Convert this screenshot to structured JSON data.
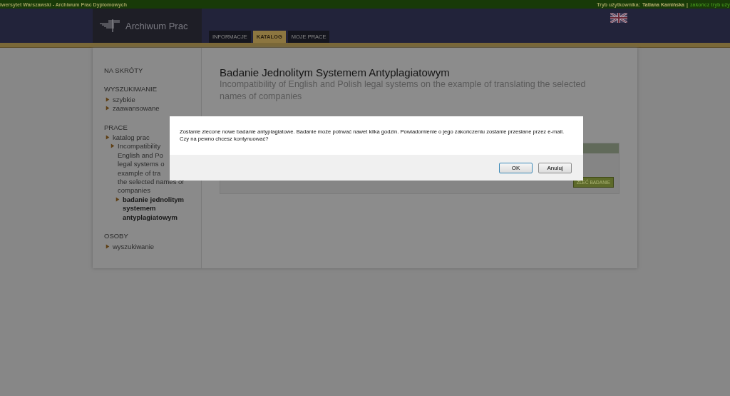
{
  "top_bar": {
    "site": "iwersytet Warszawski - Archiwum Prac Dyplomowych",
    "user_label": "Tryb użytkownika:",
    "user_name": "Tatiana Kamińska",
    "separator": "|",
    "exit_link": "zakończ tryb uży"
  },
  "header": {
    "logo_text": "Archiwum Prac"
  },
  "tabs": [
    {
      "label": "INFORMACJE",
      "selected": false
    },
    {
      "label": "KATALOG",
      "selected": true
    },
    {
      "label": "MOJE PRACE",
      "selected": false
    }
  ],
  "sidebar": {
    "sections": [
      {
        "title": "NA SKRÓTY"
      },
      {
        "title": "WYSZUKIWANIE",
        "items": [
          {
            "label": "szybkie",
            "selected": false
          },
          {
            "label": "zaawansowane",
            "selected": false
          }
        ]
      },
      {
        "title": "PRACE",
        "items": [
          {
            "label": "katalog prac",
            "selected": false,
            "children": [
              {
                "label_lines": [
                  "Incompatibility",
                  "English and Po",
                  "legal systems o",
                  "example of tra",
                  "the selected names of",
                  "companies"
                ],
                "selected": false,
                "children": [
                  {
                    "label": "badanie jednolitym systemem antyplagiatowym",
                    "selected": true
                  }
                ]
              }
            ]
          }
        ]
      },
      {
        "title": "OSOBY",
        "items": [
          {
            "label": "wyszukiwanie",
            "selected": false
          }
        ]
      }
    ]
  },
  "main": {
    "title": "Badanie Jednolitym Systemem Antyplagiatowym",
    "subtitle": "Incompatibility of English and Polish legal systems on the example of translating the selected names of companies",
    "order_button": "ZLEĆ BADANIE"
  },
  "dialog": {
    "message": "Zostanie zlecone nowe badanie antyplagiatowe. Badanie może potrwać nawet kilka godzin. Powiadomienie o jego zakończeniu zostanie przesłane przez e-mail. Czy na pewno chcesz kontynuować?",
    "buttons": [
      "OK",
      "Anuluj"
    ]
  }
}
